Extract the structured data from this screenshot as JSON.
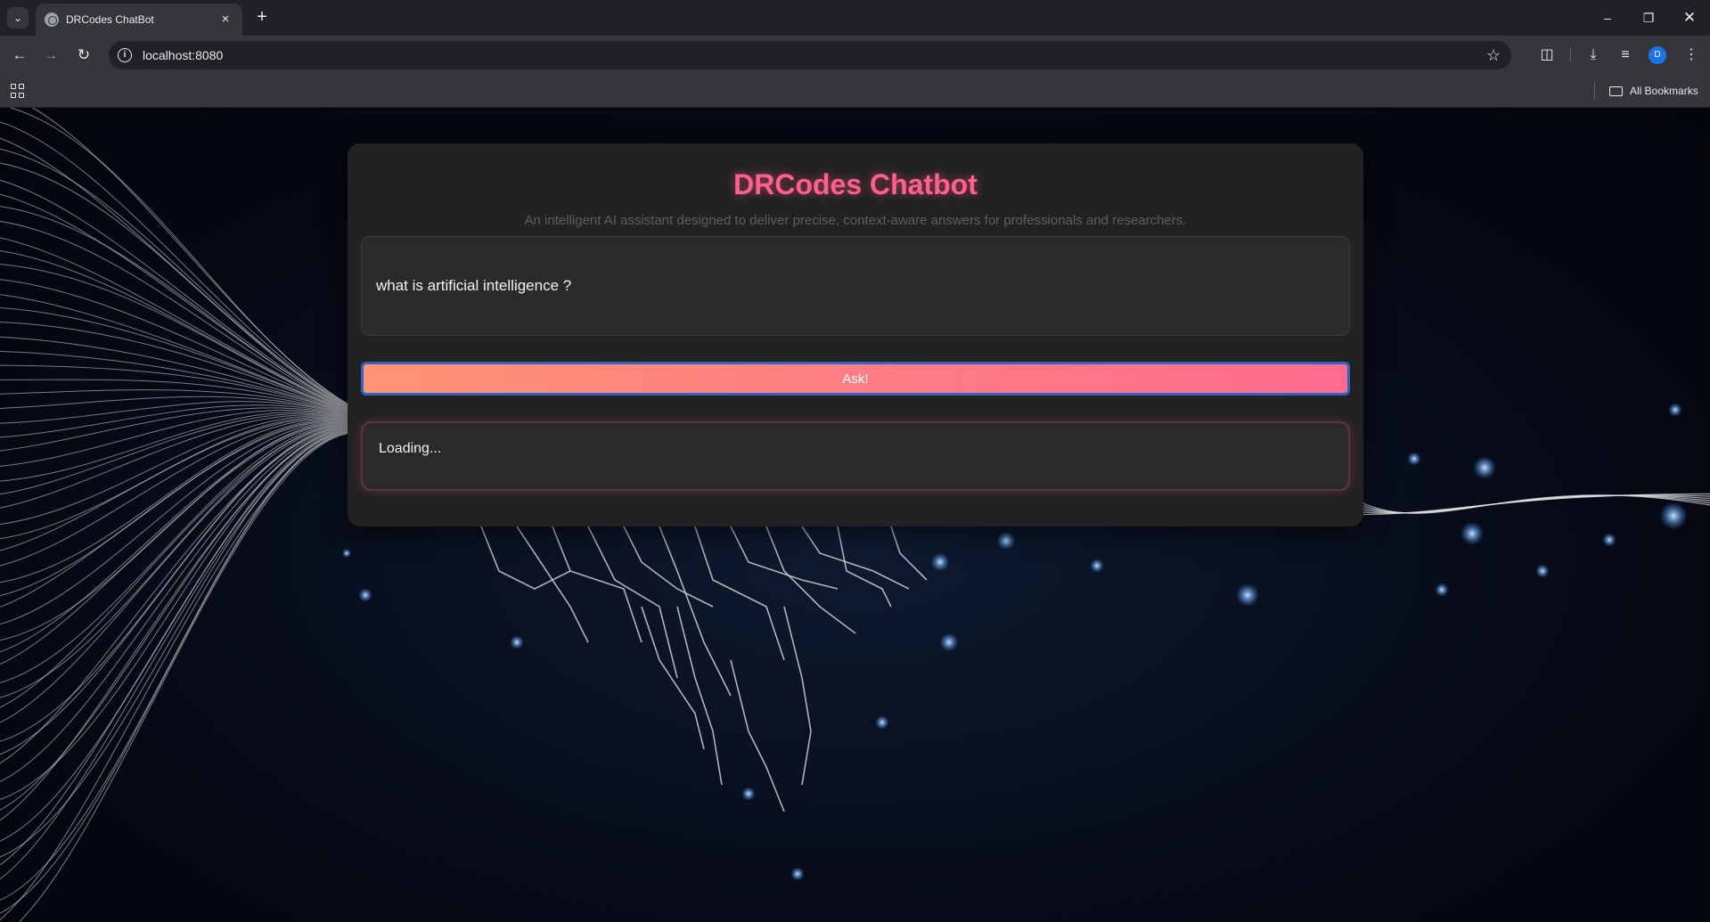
{
  "browser": {
    "tab_title": "DRCodes ChatBot",
    "url": "localhost:8080",
    "profile_initial": "D",
    "bookmarks_label": "All Bookmarks"
  },
  "page": {
    "title": "DRCodes Chatbot",
    "subtitle": "An intelligent AI assistant designed to deliver precise, context-aware answers for professionals and researchers.",
    "question_value": "what is artificial intelligence ?",
    "ask_button_label": "Ask!",
    "answer_text": "Loading...",
    "colors": {
      "title": "#ff5f8a",
      "button_gradient_start": "#ff9374",
      "button_gradient_end": "#ff6b8e",
      "card_bg": "#222222"
    }
  },
  "icons": [
    "tab-search-icon",
    "globe-favicon-icon",
    "close-icon",
    "plus-icon",
    "minimize-icon",
    "restore-icon",
    "back-arrow-icon",
    "forward-arrow-icon",
    "reload-icon",
    "site-info-icon",
    "star-icon",
    "extensions-icon",
    "download-icon",
    "media-control-icon",
    "menu-kebab-icon",
    "apps-grid-icon",
    "folder-icon"
  ]
}
